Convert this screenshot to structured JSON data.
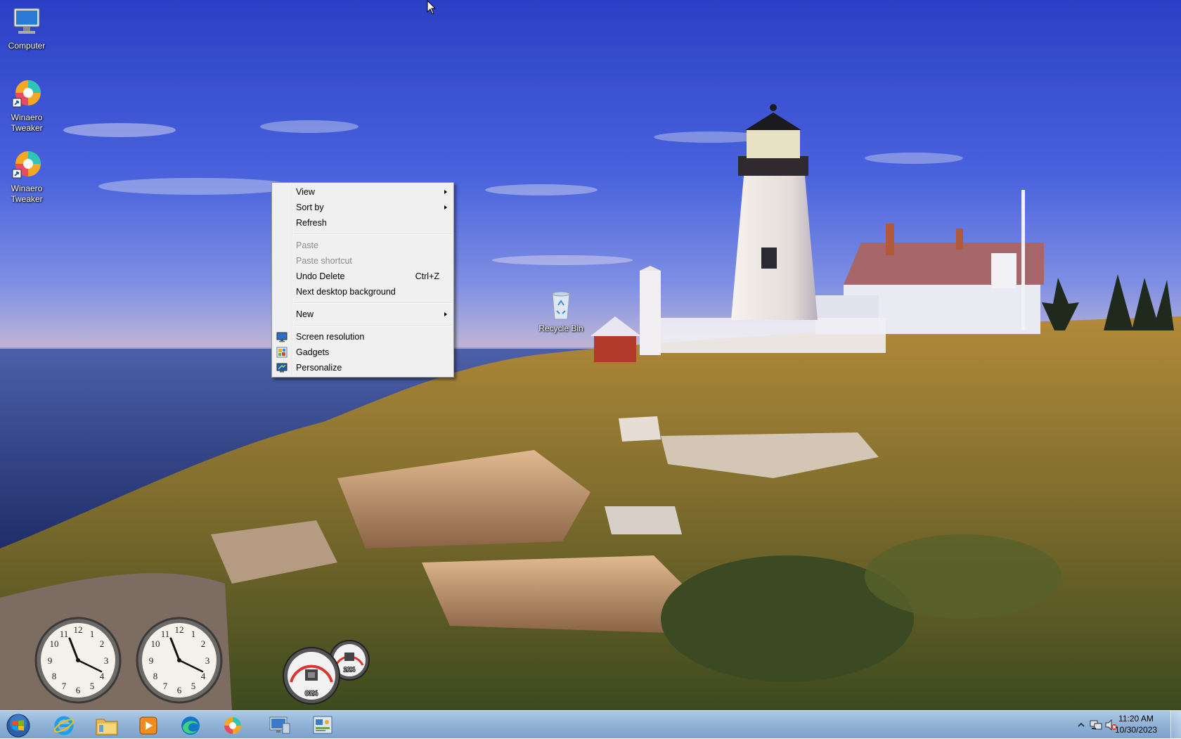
{
  "desktop_icons": [
    {
      "name": "Computer",
      "icon": "computer-icon"
    },
    {
      "name": "Winaero Tweaker",
      "icon": "winaero-tweaker-icon"
    },
    {
      "name": "Winaero Tweaker",
      "icon": "winaero-tweaker-icon"
    },
    {
      "name": "Recycle Bin",
      "icon": "recycle-bin-icon"
    }
  ],
  "context_menu": {
    "items": [
      {
        "label": "View",
        "submenu": true
      },
      {
        "label": "Sort by",
        "submenu": true
      },
      {
        "label": "Refresh"
      },
      {
        "label": "Paste",
        "disabled": true
      },
      {
        "label": "Paste shortcut",
        "disabled": true
      },
      {
        "label": "Undo Delete",
        "shortcut": "Ctrl+Z"
      },
      {
        "label": "Next desktop background"
      },
      {
        "label": "New",
        "submenu": true
      },
      {
        "label": "Screen resolution",
        "icon": "screen-resolution-icon"
      },
      {
        "label": "Gadgets",
        "icon": "gadgets-icon"
      },
      {
        "label": "Personalize",
        "icon": "personalize-icon"
      }
    ]
  },
  "gadgets": {
    "clock1_numbers": [
      "12",
      "1",
      "2",
      "3",
      "4",
      "5",
      "6",
      "7",
      "8",
      "9",
      "10",
      "11"
    ],
    "meter": {
      "cpu": "03%",
      "memory": "26%"
    }
  },
  "taskbar": {
    "pinned": [
      "start-orb-icon",
      "internet-explorer-icon",
      "file-explorer-icon",
      "media-player-icon",
      "edge-icon",
      "winaero-tweaker-icon",
      "remote-desktop-icon",
      "control-panel-icon"
    ],
    "tray_icons": [
      "show-hidden-icons-icon",
      "network-icon",
      "volume-muted-icon"
    ],
    "clock": {
      "time": "11:20 AM",
      "date": "10/30/2023"
    }
  },
  "colors": {
    "taskbar": "#8fb0d4",
    "menu_bg": "#f0f0f0",
    "disabled_text": "#8d8d8d"
  }
}
